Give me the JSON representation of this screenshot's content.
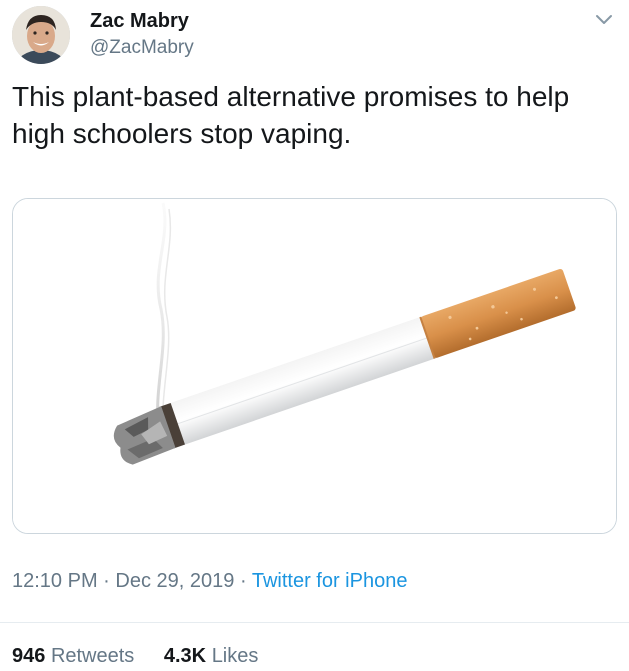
{
  "user": {
    "name": "Zac Mabry",
    "handle": "@ZacMabry"
  },
  "tweet": {
    "text": "This plant-based alternative promises to help high schoolers stop vaping."
  },
  "media": {
    "subject": "cigarette image"
  },
  "meta": {
    "time": "12:10 PM",
    "separator": "·",
    "date": "Dec 29, 2019",
    "source": "Twitter for iPhone"
  },
  "stats": {
    "retweets_count": "946",
    "retweets_label": "Retweets",
    "likes_count": "4.3K",
    "likes_label": "Likes"
  },
  "colors": {
    "text": "#14171a",
    "secondary": "#657786",
    "link": "#1b95e0",
    "border": "#ccd6dd"
  },
  "icons": {
    "menu": "chevron-down-icon"
  }
}
